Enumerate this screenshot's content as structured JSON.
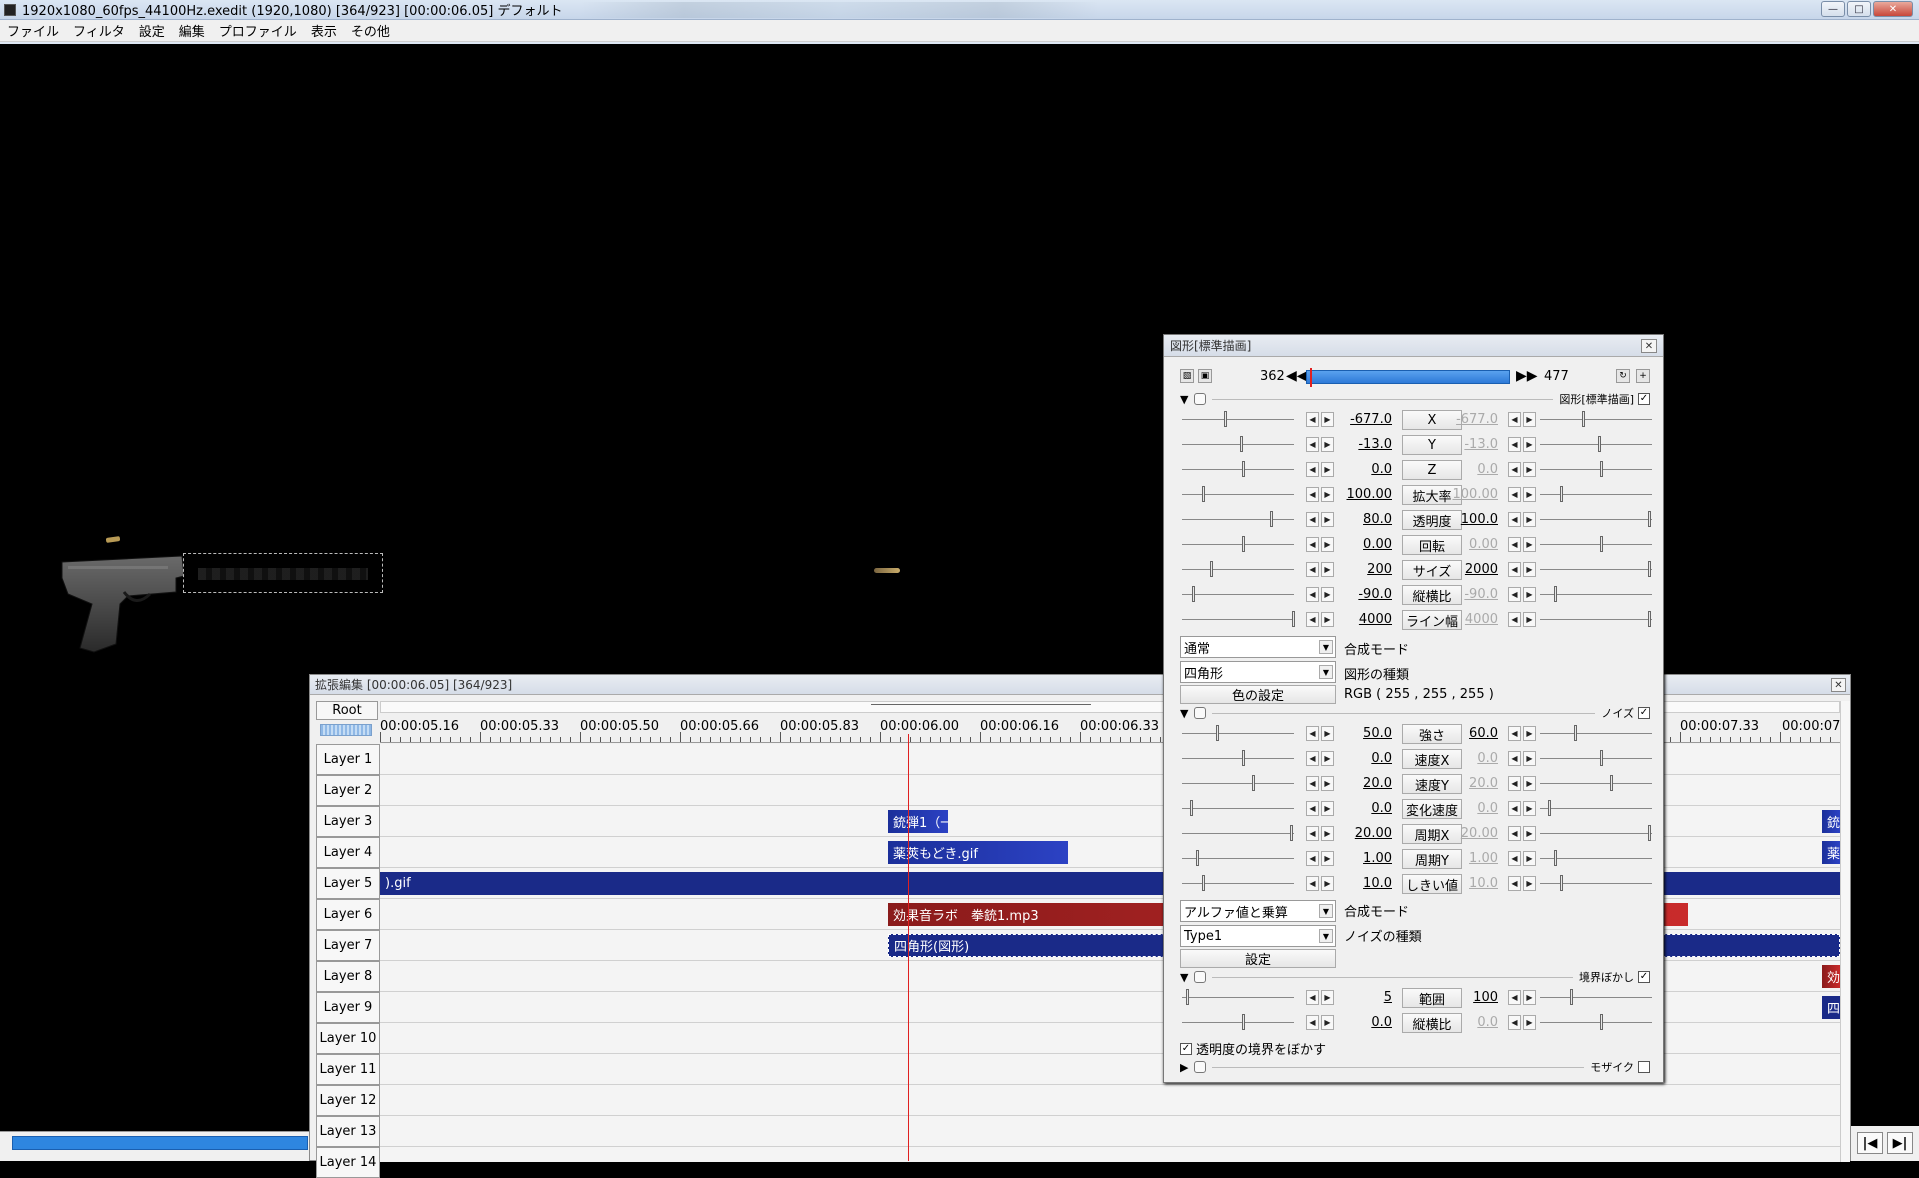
{
  "window": {
    "title": "1920x1080_60fps_44100Hz.exedit (1920,1080)  [364/923] [00:00:06.05]  デフォルト"
  },
  "menu": [
    "ファイル",
    "フィルタ",
    "設定",
    "編集",
    "プロファイル",
    "表示",
    "その他"
  ],
  "timeline": {
    "title": "拡張編集 [00:00:06.05] [364/923]",
    "root_label": "Root",
    "ruler": [
      "00:00:05.16",
      "00:00:05.33",
      "00:00:05.50",
      "00:00:05.66",
      "00:00:05.83",
      "00:00:06.00",
      "00:00:06.16",
      "00:00:06.33",
      "00:00:07.33",
      "00:00:07"
    ],
    "layers": [
      "Layer 1",
      "Layer 2",
      "Layer 3",
      "Layer 4",
      "Layer 5",
      "Layer 6",
      "Layer 7",
      "Layer 8",
      "Layer 9",
      "Layer 10",
      "Layer 11",
      "Layer 12",
      "Layer 13",
      "Layer 14"
    ],
    "clips": {
      "l3": "銃弾1（一",
      "l4": "薬莢もどき.gif",
      "l5": ").gif",
      "l6": "効果音ラボ　拳銃1.mp3",
      "l7": "四角形(図形)",
      "r3": "銃",
      "r4": "薬",
      "r8": "効",
      "r9": "四"
    }
  },
  "panel": {
    "title": "図形[標準描画]",
    "frame_start": "362",
    "frame_end": "477",
    "section1": "図形[標準描画]",
    "params1": [
      {
        "label": "X",
        "left": "-677.0",
        "right": "-677.0"
      },
      {
        "label": "Y",
        "left": "-13.0",
        "right": "-13.0"
      },
      {
        "label": "Z",
        "left": "0.0",
        "right": "0.0"
      },
      {
        "label": "拡大率",
        "left": "100.00",
        "right": "100.00"
      },
      {
        "label": "透明度",
        "left": "80.0",
        "right": "100.0"
      },
      {
        "label": "回転",
        "left": "0.00",
        "right": "0.00"
      },
      {
        "label": "サイズ",
        "left": "200",
        "right": "2000"
      },
      {
        "label": "縦横比",
        "left": "-90.0",
        "right": "-90.0"
      },
      {
        "label": "ライン幅",
        "left": "4000",
        "right": "4000"
      }
    ],
    "blend_mode": "通常",
    "blend_mode_label": "合成モード",
    "shape_type": "四角形",
    "shape_type_label": "図形の種類",
    "color_button": "色の設定",
    "rgb": "RGB ( 255 , 255 , 255 )",
    "section2": "ノイズ",
    "params2": [
      {
        "label": "強さ",
        "left": "50.0",
        "right": "60.0"
      },
      {
        "label": "速度X",
        "left": "0.0",
        "right": "0.0"
      },
      {
        "label": "速度Y",
        "left": "20.0",
        "right": "20.0"
      },
      {
        "label": "変化速度",
        "left": "0.0",
        "right": "0.0"
      },
      {
        "label": "周期X",
        "left": "20.00",
        "right": "20.00"
      },
      {
        "label": "周期Y",
        "left": "1.00",
        "right": "1.00"
      },
      {
        "label": "しきい値",
        "left": "10.0",
        "right": "10.0"
      }
    ],
    "noise_blend": "アルファ値と乗算",
    "noise_blend_label": "合成モード",
    "noise_type": "Type1",
    "noise_type_label": "ノイズの種類",
    "settings_button": "設定",
    "section3": "境界ぼかし",
    "params3": [
      {
        "label": "範囲",
        "left": "5",
        "right": "100"
      },
      {
        "label": "縦横比",
        "left": "0.0",
        "right": "0.0"
      }
    ],
    "blur_alpha_label": "透明度の境界をぼかす",
    "section4": "モザイク"
  },
  "colors": {
    "clip_blue": "#2c42c4",
    "clip_red": "#c92b2b",
    "playhead": "#e02020"
  }
}
